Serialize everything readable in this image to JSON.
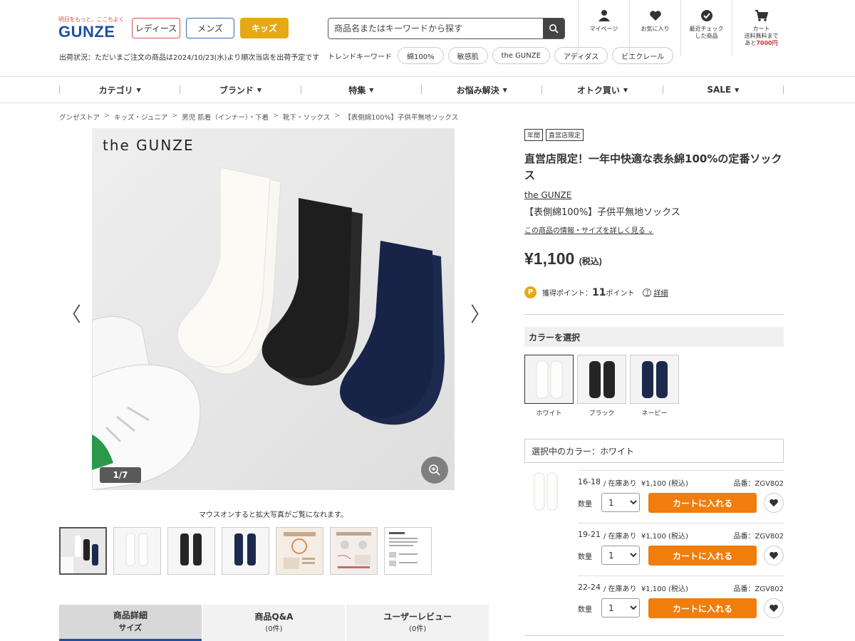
{
  "header": {
    "logo_tagline": "明日をもっと、ここちよく",
    "logo_text": "GUNZE",
    "gender_tabs": [
      "レディース",
      "メンズ",
      "キッズ"
    ],
    "shipping_notice": "出荷状況：ただいまご注文の商品は2024/10/23(水)より順次当店を出荷予定です",
    "search_placeholder": "商品名またはキーワードから探す",
    "trend_label": "トレンドキーワード",
    "trend_keywords": [
      "綿100%",
      "敏感肌",
      "the GUNZE",
      "アディダス",
      "ビエクレール"
    ],
    "icons": {
      "mypage": "マイページ",
      "favorites": "お気に入り",
      "recent_line1": "最近チェック",
      "recent_line2": "した商品",
      "cart": "カート",
      "free_shipping_line1": "送料無料まで",
      "free_shipping_prefix": "あと",
      "free_shipping_amount": "7000円"
    }
  },
  "nav": [
    "カテゴリ",
    "ブランド",
    "特集",
    "お悩み解決",
    "オトク買い",
    "SALE"
  ],
  "breadcrumb": [
    "グンゼストア",
    "キッズ・ジュニア",
    "男児 肌着（インナー）・下着",
    "靴下・ソックス",
    "【表側綿100%】子供平無地ソックス"
  ],
  "gallery": {
    "brand_overlay": "the GUNZE",
    "counter": "1/7",
    "hover_note": "マウスオンすると拡大写真がご覧になれます。",
    "prev": "〈",
    "next": "〉"
  },
  "tabs": [
    {
      "label": "商品詳細",
      "sub": "サイズ"
    },
    {
      "label": "商品Q&A",
      "sub": "(0件)"
    },
    {
      "label": "ユーザーレビュー",
      "sub": "(0件)"
    }
  ],
  "product": {
    "badges": [
      "年間",
      "直営店限定"
    ],
    "title": "直営店限定！一年中快適な表糸綿100%の定番ソックス",
    "brand": "the GUNZE",
    "name": "【表側綿100%】子供平無地ソックス",
    "info_link": "この商品の情報・サイズを詳しく見る",
    "price": "¥1,100",
    "price_tax": "(税込)",
    "points_label": "獲得ポイント：",
    "points_value": "11",
    "points_unit": "ポイント",
    "points_help": "詳細",
    "color_heading": "カラーを選択",
    "colors": [
      {
        "name": "ホワイト",
        "hex": "#f7f6f2"
      },
      {
        "name": "ブラック",
        "hex": "#252525"
      },
      {
        "name": "ネービー",
        "hex": "#1c2a4e"
      }
    ],
    "selected_color": "選択中のカラー：ホワイト",
    "qty_label": "数量",
    "cart_label": "カートに入れる",
    "sizes": [
      {
        "size": "16-18",
        "stock": "/ 在庫あり",
        "price": "¥1,100 (税込)",
        "code": "品番：ZGV802",
        "qty": "1"
      },
      {
        "size": "19-21",
        "stock": "/ 在庫あり",
        "price": "¥1,100 (税込)",
        "code": "品番：ZGV802",
        "qty": "1"
      },
      {
        "size": "22-24",
        "stock": "/ 在庫あり",
        "price": "¥1,100 (税込)",
        "code": "品番：ZGV802",
        "qty": "1"
      }
    ]
  },
  "colors": {
    "brand_blue": "#1e50a2",
    "kids_yellow": "#e5a916",
    "cart_orange": "#f07d0c",
    "ladies_red": "#d9534f"
  }
}
